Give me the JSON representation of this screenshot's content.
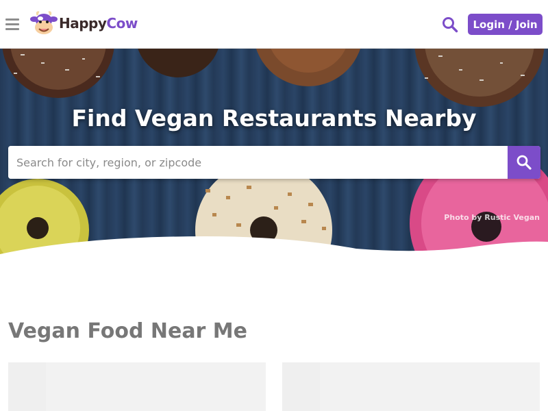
{
  "header": {
    "logo": {
      "happy": "Happy",
      "cow": "Cow"
    },
    "login_label": "Login / Join"
  },
  "hero": {
    "title": "Find Vegan Restaurants Nearby",
    "search_placeholder": "Search for city, region, or zipcode",
    "photo_credit": "Photo by Rustic Vegan"
  },
  "section": {
    "title": "Vegan Food Near Me"
  },
  "colors": {
    "brand": "#7c4dc9",
    "header_bg": "#ffffff",
    "section_title": "#777777"
  },
  "icons": {
    "menu": "hamburger-icon",
    "search": "search-icon",
    "logo": "cow-logo-icon"
  }
}
